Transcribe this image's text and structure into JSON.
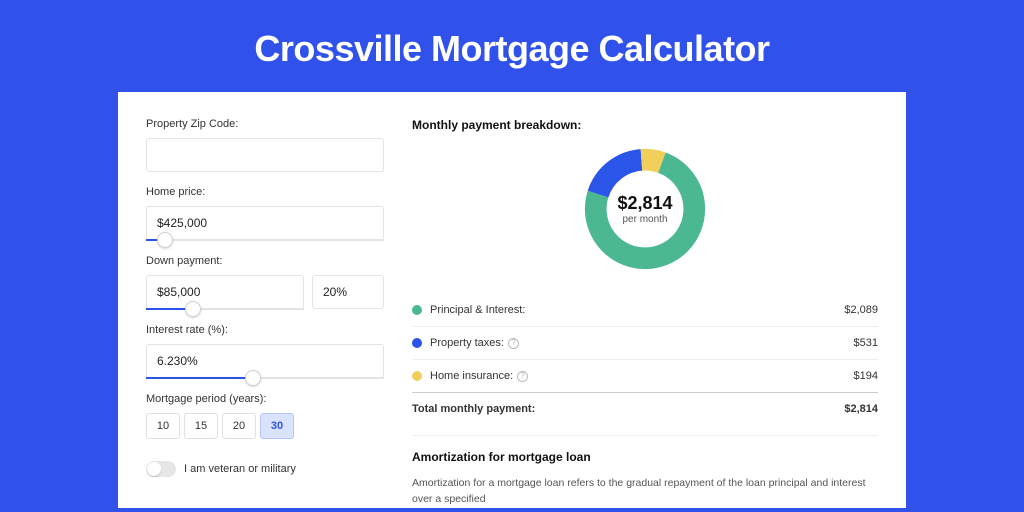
{
  "title": "Crossville Mortgage Calculator",
  "form": {
    "zip_label": "Property Zip Code:",
    "zip_value": "",
    "price_label": "Home price:",
    "price_value": "$425,000",
    "price_slider_pct": 8,
    "down_label": "Down payment:",
    "down_value": "$85,000",
    "down_pct_value": "20%",
    "down_slider_pct": 30,
    "rate_label": "Interest rate (%):",
    "rate_value": "6.230%",
    "rate_slider_pct": 45,
    "period_label": "Mortgage period (years):",
    "periods": [
      "10",
      "15",
      "20",
      "30"
    ],
    "period_active": 3,
    "veteran_label": "I am veteran or military"
  },
  "breakdown": {
    "title": "Monthly payment breakdown:",
    "center_value": "$2,814",
    "center_sub": "per month",
    "items": [
      {
        "label": "Principal & Interest:",
        "value": "$2,089",
        "color": "#4cb892",
        "info": false
      },
      {
        "label": "Property taxes:",
        "value": "$531",
        "color": "#2b54e8",
        "info": true
      },
      {
        "label": "Home insurance:",
        "value": "$194",
        "color": "#f1cf5b",
        "info": true
      }
    ],
    "total_label": "Total monthly payment:",
    "total_value": "$2,814"
  },
  "amort": {
    "title": "Amortization for mortgage loan",
    "desc": "Amortization for a mortgage loan refers to the gradual repayment of the loan principal and interest over a specified"
  },
  "chart_data": {
    "type": "pie",
    "title": "Monthly payment breakdown",
    "series": [
      {
        "name": "Principal & Interest",
        "value": 2089,
        "color": "#4cb892"
      },
      {
        "name": "Property taxes",
        "value": 531,
        "color": "#2b54e8"
      },
      {
        "name": "Home insurance",
        "value": 194,
        "color": "#f1cf5b"
      }
    ],
    "total": 2814,
    "unit": "USD per month",
    "donut": true,
    "start_angle_deg": -20
  }
}
